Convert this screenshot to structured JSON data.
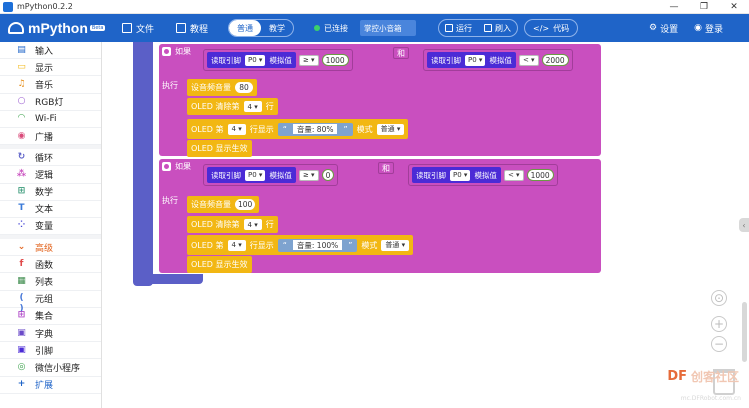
{
  "window": {
    "title": "mPython0.2.2",
    "controls": [
      "—",
      "❐",
      "✕"
    ]
  },
  "header": {
    "logo_text": "mPython",
    "logo_badge": "Beta",
    "file_label": "文件",
    "tutorial_label": "教程",
    "mode_normal": "普通",
    "mode_teach": "教学",
    "status_label": "已连接",
    "device": "掌控小音箱",
    "run_label": "运行",
    "flash_label": "刷入",
    "code_label": "代码",
    "settings_label": "设置",
    "login_label": "登录",
    "colors": {
      "header": "#1f64c8",
      "status_ok": "#3cd26a"
    }
  },
  "sidebar": {
    "items": [
      {
        "label": "输入",
        "icon": "input-icon",
        "color": "#1f64c8"
      },
      {
        "label": "显示",
        "icon": "display-icon",
        "color": "#f2b713"
      },
      {
        "label": "音乐",
        "icon": "music-icon",
        "color": "#e58e1a"
      },
      {
        "label": "RGB灯",
        "icon": "bulb-icon",
        "color": "#9a5cd0"
      },
      {
        "label": "Wi-Fi",
        "icon": "wifi-icon",
        "color": "#3aa04a"
      },
      {
        "label": "广播",
        "icon": "broadcast-icon",
        "color": "#d94b7a"
      },
      {
        "label": "循环",
        "icon": "loop-icon",
        "color": "#5b5fc7"
      },
      {
        "label": "逻辑",
        "icon": "logic-icon",
        "color": "#c94fbf"
      },
      {
        "label": "数学",
        "icon": "math-icon",
        "color": "#3a9a7a"
      },
      {
        "label": "文本",
        "icon": "text-icon",
        "color": "#3a7ad8"
      },
      {
        "label": "变量",
        "icon": "variable-icon",
        "color": "#4a4ad6"
      },
      {
        "label": "高级",
        "icon": "chevron-down-icon",
        "color": "#e2611a"
      },
      {
        "label": "函数",
        "icon": "function-icon",
        "color": "#e04a4a"
      },
      {
        "label": "列表",
        "icon": "list-icon",
        "color": "#3a8a4a"
      },
      {
        "label": "元组",
        "icon": "tuple-icon",
        "color": "#4a7ad8"
      },
      {
        "label": "集合",
        "icon": "set-icon",
        "color": "#b04ac8"
      },
      {
        "label": "字典",
        "icon": "dict-icon",
        "color": "#6a4ac8"
      },
      {
        "label": "引脚",
        "icon": "pin-icon",
        "color": "#4b2bd6"
      },
      {
        "label": "微信小程序",
        "icon": "wechat-icon",
        "color": "#3aa04a"
      },
      {
        "label": "扩展",
        "icon": "extend-icon",
        "color": "#1f64c8"
      }
    ]
  },
  "blocks": {
    "if_label": "如果",
    "exec_label": "执行",
    "and_label": "和",
    "read_pin": "读取引脚",
    "analog": "模拟值",
    "pin_p0": "P0",
    "block1": {
      "op1": "≥",
      "val1": "1000",
      "op2": "<",
      "val2": "2000",
      "volume_label": "设音频音量",
      "volume": "80",
      "clear_label": "OLED 清除第",
      "clear_row": "4",
      "row_label": "行",
      "show_label": "OLED 第",
      "show_row": "4",
      "show_mid": "行显示",
      "text": "音量: 80%",
      "mode_label": "模式",
      "mode": "普通",
      "effect": "OLED 显示生效"
    },
    "block2": {
      "op1": "≥",
      "val1": "0",
      "op2": "<",
      "val2": "1000",
      "volume_label": "设音频音量",
      "volume": "100",
      "clear_label": "OLED 清除第",
      "clear_row": "4",
      "row_label": "行",
      "show_label": "OLED 第",
      "show_row": "4",
      "show_mid": "行显示",
      "text": "音量: 100%",
      "mode_label": "模式",
      "mode": "普通",
      "effect": "OLED 显示生效"
    }
  },
  "watermark": {
    "brand": "DF",
    "name": "创客社区",
    "url": "mc.DFRobot.com.cn"
  }
}
